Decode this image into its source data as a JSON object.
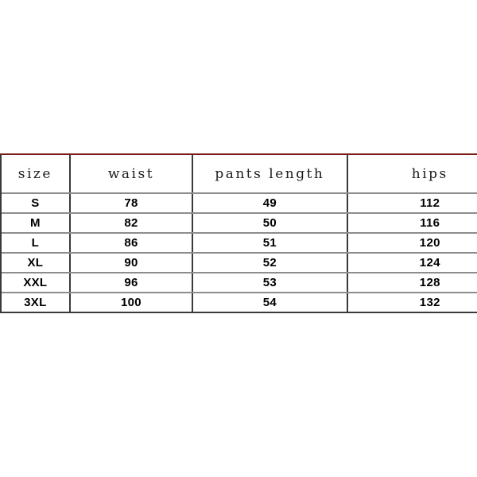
{
  "table": {
    "columns": [
      "size",
      "waist",
      "pants length",
      "hips"
    ],
    "rows": [
      {
        "size": "S",
        "waist": "78",
        "pants_length": "49",
        "hips": "112"
      },
      {
        "size": "M",
        "waist": "82",
        "pants_length": "50",
        "hips": "116"
      },
      {
        "size": "L",
        "waist": "86",
        "pants_length": "51",
        "hips": "120"
      },
      {
        "size": "XL",
        "waist": "90",
        "pants_length": "52",
        "hips": "124"
      },
      {
        "size": "XXL",
        "waist": "96",
        "pants_length": "53",
        "hips": "128"
      },
      {
        "size": "3XL",
        "waist": "100",
        "pants_length": "54",
        "hips": "132"
      }
    ]
  },
  "colors": {
    "top_border": "#7a1a15",
    "grid_vertical": "#3a3a3a",
    "grid_horizontal": "#8d8d8d",
    "background": "#ffffff",
    "header_text": "#1c1c1c",
    "cell_text": "#000000"
  }
}
